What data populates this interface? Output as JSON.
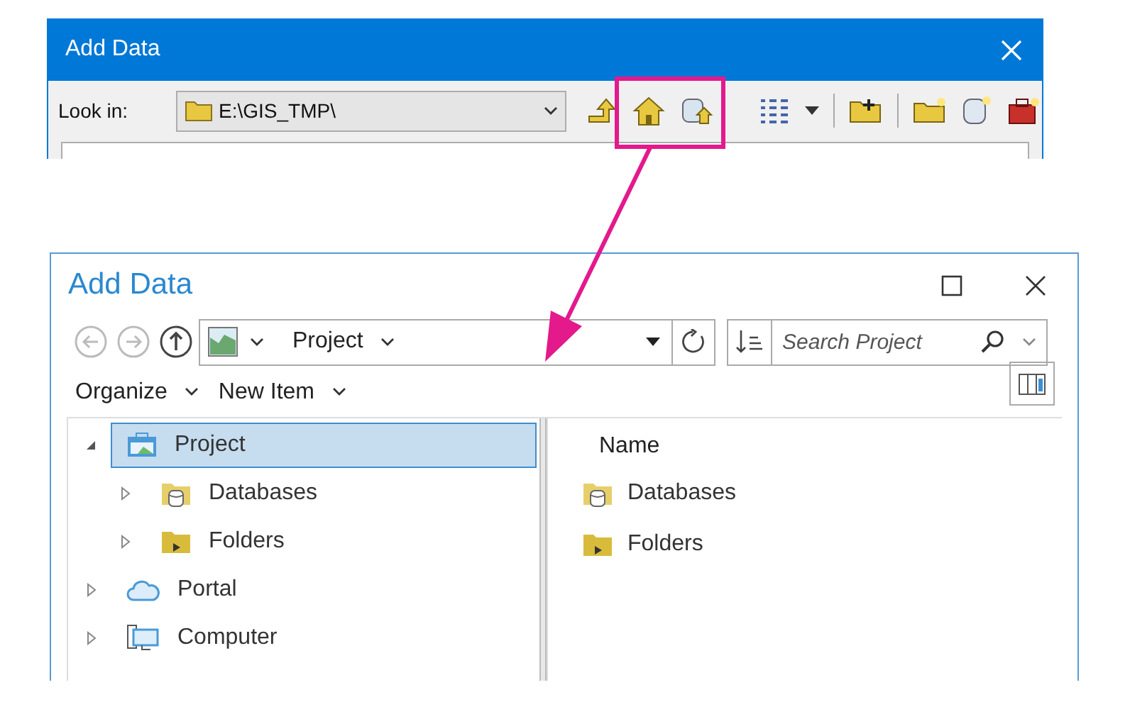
{
  "old_dialog": {
    "title": "Add Data",
    "look_in_label": "Look in:",
    "location": "E:\\GIS_TMP\\"
  },
  "new_dialog": {
    "title": "Add Data",
    "location": "Project",
    "search": {
      "placeholder": "Search Project"
    },
    "menus": [
      "Organize",
      "New Item"
    ],
    "tree": [
      {
        "label": "Project",
        "kind": "project",
        "selected": true,
        "expanded": true,
        "children": [
          {
            "label": "Databases",
            "kind": "database",
            "selected": false,
            "expanded": false
          },
          {
            "label": "Folders",
            "kind": "folder",
            "selected": false,
            "expanded": false
          }
        ]
      },
      {
        "label": "Portal",
        "kind": "portal",
        "selected": false,
        "expanded": false
      },
      {
        "label": "Computer",
        "kind": "computer",
        "selected": false,
        "expanded": false
      }
    ],
    "list": {
      "column": "Name",
      "items": [
        {
          "label": "Databases",
          "kind": "database"
        },
        {
          "label": "Folders",
          "kind": "folder"
        }
      ]
    }
  }
}
